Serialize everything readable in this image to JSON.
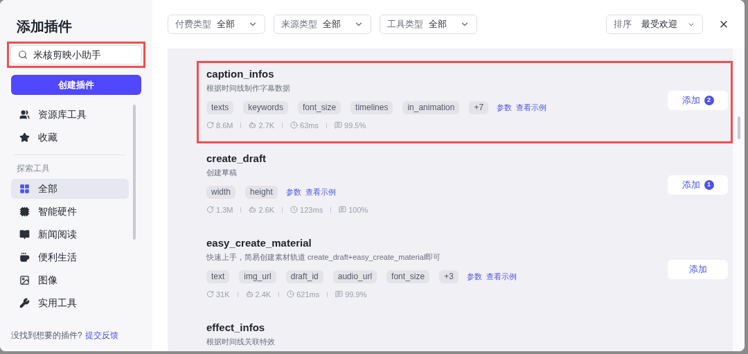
{
  "sidebar": {
    "title": "添加插件",
    "search": {
      "value": "米核剪映小助手",
      "highlighted": true
    },
    "create_button": "创建插件",
    "top_items": [
      {
        "label": "资源库工具",
        "selected": false
      },
      {
        "label": "收藏",
        "selected": false
      }
    ],
    "section_label": "探索工具",
    "items": [
      {
        "label": "全部",
        "selected": true
      },
      {
        "label": "智能硬件",
        "selected": false
      },
      {
        "label": "新闻阅读",
        "selected": false
      },
      {
        "label": "便利生活",
        "selected": false
      },
      {
        "label": "图像",
        "selected": false
      },
      {
        "label": "实用工具",
        "selected": false
      }
    ],
    "footer": {
      "text": "没找到想要的插件?",
      "link": "提交反馈"
    }
  },
  "filters": [
    {
      "label": "付费类型",
      "value": "全部"
    },
    {
      "label": "来源类型",
      "value": "全部"
    },
    {
      "label": "工具类型",
      "value": "全部"
    }
  ],
  "sort": {
    "label": "排序",
    "value": "最受欢迎"
  },
  "plugins": [
    {
      "name": "caption_infos",
      "description": "根据时间线制作字幕数据",
      "highlighted": true,
      "params": [
        "texts",
        "keywords",
        "font_size",
        "timelines",
        "in_animation",
        "+7"
      ],
      "links": [
        "参数",
        "查看示例"
      ],
      "stats": [
        "8.6M",
        "2.7K",
        "63ms",
        "99.5%"
      ],
      "button": "添加",
      "count": "2"
    },
    {
      "name": "create_draft",
      "description": "创建草稿",
      "highlighted": false,
      "params": [
        "width",
        "height"
      ],
      "links": [
        "参数",
        "查看示例"
      ],
      "stats": [
        "1.3M",
        "2.6K",
        "123ms",
        "100%"
      ],
      "button": "添加",
      "count": "1"
    },
    {
      "name": "easy_create_material",
      "description": "快速上手，简易创建素材轨道 create_draft+easy_create_material即可",
      "highlighted": false,
      "params": [
        "text",
        "img_url",
        "draft_id",
        "audio_url",
        "font_size",
        "+3"
      ],
      "links": [
        "参数",
        "查看示例"
      ],
      "stats": [
        "31K",
        "2.4K",
        "621ms",
        "99.9%"
      ],
      "button": "添加"
    },
    {
      "name": "effect_infos",
      "description": "根据时间线关联特效",
      "highlighted": false
    }
  ]
}
